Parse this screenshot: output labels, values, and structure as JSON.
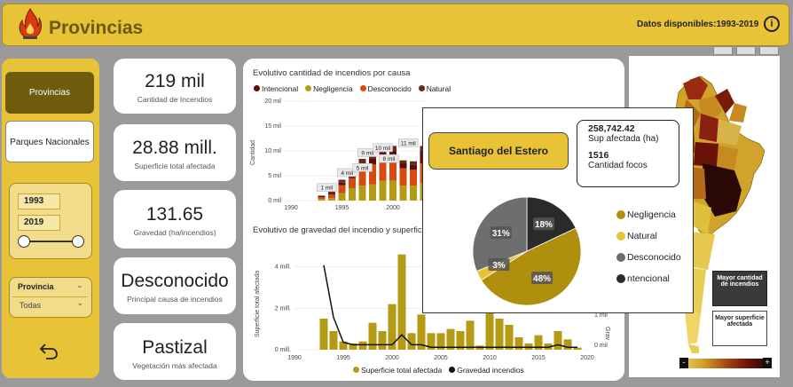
{
  "header": {
    "title": "Provincias",
    "availability": "Datos disponibles:1993-2019",
    "info_label": "i"
  },
  "nav": {
    "provincias": "Provincias",
    "parques": "Parques Nacionales"
  },
  "filters": {
    "year_from": "1993",
    "year_to": "2019",
    "province_label": "Provincia",
    "province_value": "Todas"
  },
  "kpis": [
    {
      "value": "219 mil",
      "label": "Cantidad de Incendios"
    },
    {
      "value": "28.88 mill.",
      "label": "Superficie total afectada"
    },
    {
      "value": "131.65",
      "label": "Gravedad (ha/incendios)"
    },
    {
      "value": "Desconocido",
      "label": "Principal causa de incendios"
    },
    {
      "value": "Pastizal",
      "label": "Vegetación más afectada"
    }
  ],
  "chart_data": [
    {
      "type": "bar",
      "title": "Evolutivo cantidad de incendios por causa",
      "ylabel": "Cantidad",
      "ylim": [
        0,
        20
      ],
      "y_ticks": [
        "0 mil",
        "5 mil",
        "10 mil",
        "15 mil",
        "20 mil"
      ],
      "x_ticks": [
        "1990",
        "1995",
        "2000"
      ],
      "legend": [
        {
          "name": "Intencional",
          "color": "#5a0d0d"
        },
        {
          "name": "Negligencia",
          "color": "#b59a14"
        },
        {
          "name": "Desconocido",
          "color": "#d94a10"
        },
        {
          "name": "Natural",
          "color": "#6a2a18"
        }
      ],
      "categories": [
        "1993",
        "1994",
        "1995",
        "1996",
        "1997",
        "1998",
        "1999",
        "2000",
        "2001",
        "2002",
        "2003"
      ],
      "series": [
        {
          "name": "Negligencia",
          "values": [
            0.3,
            0.5,
            1.5,
            2.5,
            3.0,
            3.3,
            4.0,
            4.0,
            3.0,
            3.0,
            3.5
          ]
        },
        {
          "name": "Desconocido",
          "values": [
            0.4,
            0.7,
            1.6,
            2.0,
            3.5,
            4.0,
            4.5,
            4.5,
            3.5,
            3.2,
            4.0
          ]
        },
        {
          "name": "Intencional",
          "values": [
            0.2,
            0.3,
            0.5,
            0.9,
            1.0,
            1.1,
            1.2,
            1.5,
            1.0,
            1.0,
            2.5
          ]
        },
        {
          "name": "Natural",
          "values": [
            0.1,
            0.3,
            0.6,
            0.6,
            0.9,
            1.1,
            1.3,
            1.0,
            0.6,
            0.7,
            1.0
          ]
        }
      ],
      "data_labels": [
        "1 mil",
        "4 mil",
        "5 mil",
        "9 mil",
        "10 mil",
        "8 mil",
        "11 mil",
        "13 mil",
        "18 mil"
      ]
    },
    {
      "type": "bar",
      "title": "Evolutivo de gravedad del incendio y superficie",
      "ylabel": "Superficie total afectada",
      "y2label": "Grav",
      "ylim": [
        0,
        4.8
      ],
      "y_ticks": [
        "0 mill.",
        "2 mill.",
        "4 mill."
      ],
      "y2_ticks": [
        "1 mil",
        "0 mil"
      ],
      "x_ticks": [
        "1990",
        "1995",
        "2000",
        "2005",
        "2010",
        "2015",
        "2020"
      ],
      "legend": [
        {
          "name": "Superficie total afectada",
          "color": "#b59a14"
        },
        {
          "name": "Gravedad incendios",
          "color": "#111111"
        }
      ],
      "categories": [
        "1993",
        "1994",
        "1995",
        "1996",
        "1997",
        "1998",
        "1999",
        "2000",
        "2001",
        "2002",
        "2003",
        "2004",
        "2005",
        "2006",
        "2007",
        "2008",
        "2009",
        "2010",
        "2011",
        "2012",
        "2013",
        "2014",
        "2015",
        "2016",
        "2017",
        "2018",
        "2019"
      ],
      "series": [
        {
          "name": "Superficie total afectada",
          "values": [
            1.5,
            0.9,
            0.4,
            0.3,
            0.4,
            1.3,
            0.9,
            2.2,
            4.6,
            0.8,
            1.7,
            0.8,
            0.8,
            1.0,
            0.9,
            1.4,
            0.2,
            1.9,
            1.5,
            1.2,
            0.6,
            0.3,
            0.7,
            0.3,
            0.9,
            0.5,
            0.1
          ]
        },
        {
          "name": "Gravedad incendios",
          "values": [
            3.4,
            1.3,
            0.3,
            0.2,
            0.2,
            0.2,
            0.2,
            0.2,
            0.6,
            0.2,
            0.2,
            0.1,
            0.1,
            0.1,
            0.1,
            0.1,
            0.1,
            0.1,
            0.1,
            0.1,
            0.1,
            0.1,
            0.1,
            0.1,
            0.2,
            0.1,
            0.1
          ]
        }
      ]
    },
    {
      "type": "pie",
      "labels": [
        "Negligencia",
        "Natural",
        "Desconocido",
        "Intencional"
      ],
      "values": [
        48,
        3,
        31,
        18
      ],
      "data_labels": [
        "48%",
        "3%",
        "31%",
        "18%"
      ],
      "colors": [
        "#b08f0e",
        "#e8c237",
        "#6e6e6e",
        "#2a2a2a"
      ],
      "legend_labels": [
        "Negligencia",
        "Natural",
        "Desconocido",
        "ntencional"
      ]
    }
  ],
  "popup": {
    "province": "Santiago del Estero",
    "area_value": "258,742.42",
    "area_label": "Sup afectada (ha)",
    "count_value": "1516",
    "count_label": "Cantidad focos"
  },
  "map": {
    "btn_mayor_cantidad": "Mayor cantidad de incendios",
    "btn_mayor_superficie": "Mayor superficie afectada",
    "scale_min": "-",
    "scale_max": "+"
  },
  "colors": {
    "header": "#e8c237",
    "accent_dark": "#6e5b0e"
  }
}
